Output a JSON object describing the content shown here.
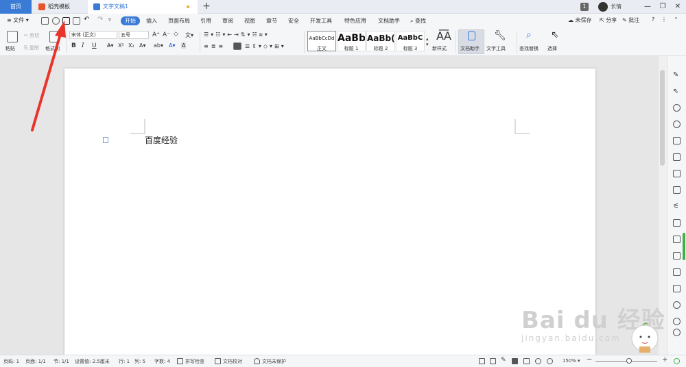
{
  "tabbar": {
    "home": "首页",
    "template_tab": "稻壳模板",
    "doc_tab": "文字文稿1",
    "new_tab": "+",
    "badge": "1",
    "user": "长情",
    "minimize": "—",
    "restore": "❐",
    "close": "✕"
  },
  "menubar": {
    "file_menu": "文件",
    "tabs": [
      "开始",
      "插入",
      "页面布局",
      "引用",
      "审阅",
      "视图",
      "章节",
      "安全",
      "开发工具",
      "特色应用",
      "文档助手"
    ],
    "search": "查找",
    "unsaved": "未保存",
    "share": "分享",
    "annotate": "批注"
  },
  "ribbon": {
    "paste": "粘贴",
    "cut": "剪切",
    "copy": "复制",
    "format_painter": "格式刷",
    "font_name": "宋体 (正文)",
    "font_size": "五号",
    "bold": "B",
    "italic": "I",
    "underline": "U",
    "styles": [
      {
        "sample": "AaBbCcDd",
        "name": "正文"
      },
      {
        "sample": "AaBb",
        "name": "标题 1"
      },
      {
        "sample": "AaBb(",
        "name": "标题 2"
      },
      {
        "sample": "AaBbC",
        "name": "标题 3"
      }
    ],
    "new_style": "新样式",
    "doc_assistant": "文档助手",
    "text_tools": "文字工具",
    "find_replace": "查找替换",
    "select": "选择"
  },
  "document": {
    "text": "百度经验"
  },
  "statusbar": {
    "page_num": "页码: 1",
    "pages": "页面: 1/1",
    "section": "节: 1/1",
    "setting": "设置值: 2.5厘米",
    "row": "行: 1",
    "col": "列: 5",
    "word_count": "字数: 4",
    "spell_check": "拼写检查",
    "proofread": "文档校对",
    "protection": "文档未保护",
    "zoom": "150%"
  },
  "watermark": {
    "logo": "Bai du 经验",
    "url": "jingyan.baidu.com"
  },
  "colors": {
    "accent": "#3a7bd5",
    "arrow": "#e8342a",
    "green": "#3cb24a"
  }
}
